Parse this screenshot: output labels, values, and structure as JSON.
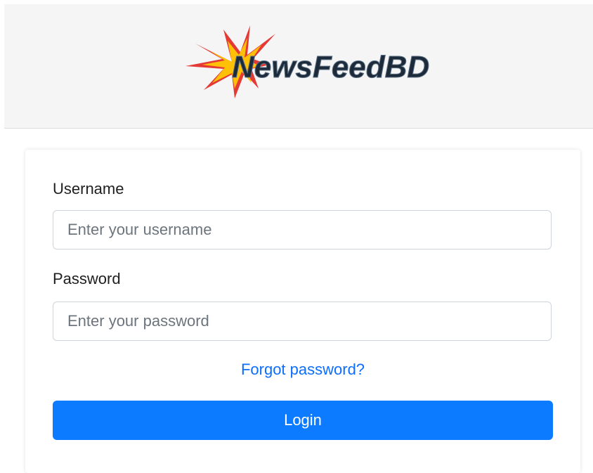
{
  "header": {
    "logo_text": "NewsFeedBD",
    "logo_icon": "starburst-icon"
  },
  "form": {
    "username_label": "Username",
    "username_placeholder": "Enter your username",
    "username_value": "",
    "password_label": "Password",
    "password_placeholder": "Enter your password",
    "password_value": "",
    "forgot_link": "Forgot password?",
    "login_button": "Login"
  },
  "colors": {
    "header_bg": "#f5f5f5",
    "link": "#0d6efd",
    "primary_button": "#0d7bff",
    "logo_star_outer": "#e53935",
    "logo_star_inner": "#ffc107"
  }
}
